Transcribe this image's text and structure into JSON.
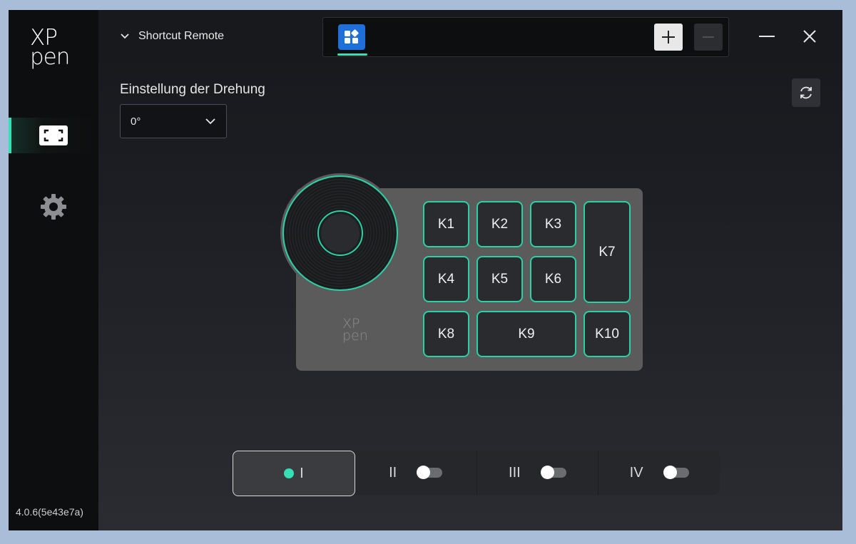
{
  "app": {
    "logo_line1": "XP",
    "logo_line2": "pen",
    "version": "4.0.6(5e43e7a)"
  },
  "sidebar": {
    "items": [
      {
        "icon": "screen-mapping-icon",
        "active": true
      },
      {
        "icon": "gear-icon",
        "active": false
      }
    ]
  },
  "header": {
    "device_name": "Shortcut Remote",
    "app_tab_icon": "all-apps-icon",
    "add_label": "+",
    "remove_label": "—"
  },
  "rotation": {
    "label": "Einstellung der Drehung",
    "value": "0°"
  },
  "device": {
    "logo_line1": "XP",
    "logo_line2": "pen",
    "keys": {
      "k1": "K1",
      "k2": "K2",
      "k3": "K3",
      "k4": "K4",
      "k5": "K5",
      "k6": "K6",
      "k7": "K7",
      "k8": "K8",
      "k9": "K9",
      "k10": "K10"
    }
  },
  "modes": [
    {
      "label": "I",
      "active": true
    },
    {
      "label": "II",
      "active": false
    },
    {
      "label": "III",
      "active": false
    },
    {
      "label": "IV",
      "active": false
    }
  ],
  "colors": {
    "accent": "#35e0b4",
    "app_tab": "#1e6fd8",
    "key_border": "#2bd1a6"
  }
}
